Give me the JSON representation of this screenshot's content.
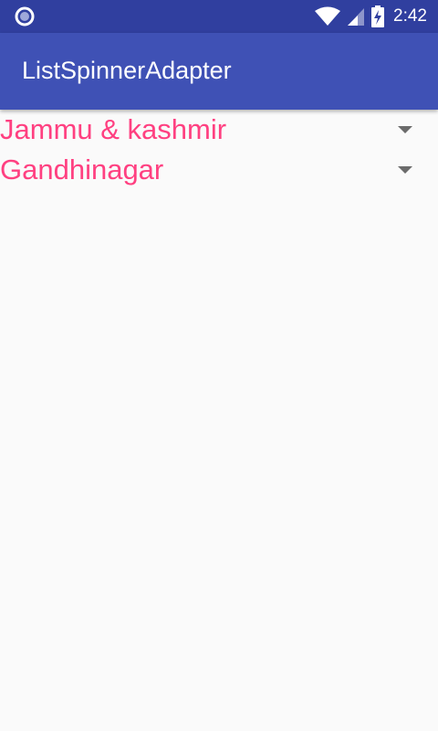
{
  "status_bar": {
    "time": "2:42",
    "left_icon": "circle-notification-icon",
    "icons": [
      "wifi-icon",
      "cell-signal-icon",
      "battery-charging-icon"
    ]
  },
  "app_bar": {
    "title": "ListSpinnerAdapter"
  },
  "spinners": [
    {
      "selected_value": "Jammu & kashmir",
      "icon": "dropdown-arrow-icon"
    },
    {
      "selected_value": "Gandhinagar",
      "icon": "dropdown-arrow-icon"
    }
  ],
  "colors": {
    "status_bar": "#303f9f",
    "app_bar": "#3f51b5",
    "accent": "#ff4081",
    "background": "#fafafa"
  }
}
